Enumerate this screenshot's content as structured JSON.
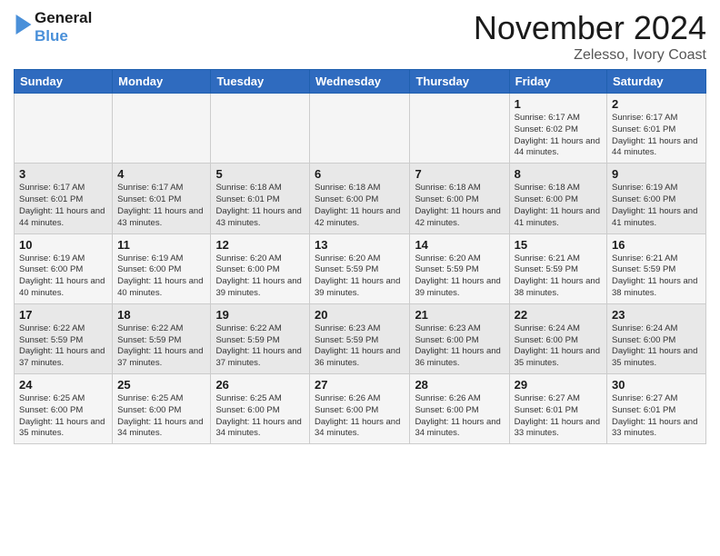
{
  "header": {
    "logo_line1": "General",
    "logo_line2": "Blue",
    "month_title": "November 2024",
    "location": "Zelesso, Ivory Coast"
  },
  "weekdays": [
    "Sunday",
    "Monday",
    "Tuesday",
    "Wednesday",
    "Thursday",
    "Friday",
    "Saturday"
  ],
  "weeks": [
    [
      {
        "day": "",
        "info": ""
      },
      {
        "day": "",
        "info": ""
      },
      {
        "day": "",
        "info": ""
      },
      {
        "day": "",
        "info": ""
      },
      {
        "day": "",
        "info": ""
      },
      {
        "day": "1",
        "info": "Sunrise: 6:17 AM\nSunset: 6:02 PM\nDaylight: 11 hours and 44 minutes."
      },
      {
        "day": "2",
        "info": "Sunrise: 6:17 AM\nSunset: 6:01 PM\nDaylight: 11 hours and 44 minutes."
      }
    ],
    [
      {
        "day": "3",
        "info": "Sunrise: 6:17 AM\nSunset: 6:01 PM\nDaylight: 11 hours and 44 minutes."
      },
      {
        "day": "4",
        "info": "Sunrise: 6:17 AM\nSunset: 6:01 PM\nDaylight: 11 hours and 43 minutes."
      },
      {
        "day": "5",
        "info": "Sunrise: 6:18 AM\nSunset: 6:01 PM\nDaylight: 11 hours and 43 minutes."
      },
      {
        "day": "6",
        "info": "Sunrise: 6:18 AM\nSunset: 6:00 PM\nDaylight: 11 hours and 42 minutes."
      },
      {
        "day": "7",
        "info": "Sunrise: 6:18 AM\nSunset: 6:00 PM\nDaylight: 11 hours and 42 minutes."
      },
      {
        "day": "8",
        "info": "Sunrise: 6:18 AM\nSunset: 6:00 PM\nDaylight: 11 hours and 41 minutes."
      },
      {
        "day": "9",
        "info": "Sunrise: 6:19 AM\nSunset: 6:00 PM\nDaylight: 11 hours and 41 minutes."
      }
    ],
    [
      {
        "day": "10",
        "info": "Sunrise: 6:19 AM\nSunset: 6:00 PM\nDaylight: 11 hours and 40 minutes."
      },
      {
        "day": "11",
        "info": "Sunrise: 6:19 AM\nSunset: 6:00 PM\nDaylight: 11 hours and 40 minutes."
      },
      {
        "day": "12",
        "info": "Sunrise: 6:20 AM\nSunset: 6:00 PM\nDaylight: 11 hours and 39 minutes."
      },
      {
        "day": "13",
        "info": "Sunrise: 6:20 AM\nSunset: 5:59 PM\nDaylight: 11 hours and 39 minutes."
      },
      {
        "day": "14",
        "info": "Sunrise: 6:20 AM\nSunset: 5:59 PM\nDaylight: 11 hours and 39 minutes."
      },
      {
        "day": "15",
        "info": "Sunrise: 6:21 AM\nSunset: 5:59 PM\nDaylight: 11 hours and 38 minutes."
      },
      {
        "day": "16",
        "info": "Sunrise: 6:21 AM\nSunset: 5:59 PM\nDaylight: 11 hours and 38 minutes."
      }
    ],
    [
      {
        "day": "17",
        "info": "Sunrise: 6:22 AM\nSunset: 5:59 PM\nDaylight: 11 hours and 37 minutes."
      },
      {
        "day": "18",
        "info": "Sunrise: 6:22 AM\nSunset: 5:59 PM\nDaylight: 11 hours and 37 minutes."
      },
      {
        "day": "19",
        "info": "Sunrise: 6:22 AM\nSunset: 5:59 PM\nDaylight: 11 hours and 37 minutes."
      },
      {
        "day": "20",
        "info": "Sunrise: 6:23 AM\nSunset: 5:59 PM\nDaylight: 11 hours and 36 minutes."
      },
      {
        "day": "21",
        "info": "Sunrise: 6:23 AM\nSunset: 6:00 PM\nDaylight: 11 hours and 36 minutes."
      },
      {
        "day": "22",
        "info": "Sunrise: 6:24 AM\nSunset: 6:00 PM\nDaylight: 11 hours and 35 minutes."
      },
      {
        "day": "23",
        "info": "Sunrise: 6:24 AM\nSunset: 6:00 PM\nDaylight: 11 hours and 35 minutes."
      }
    ],
    [
      {
        "day": "24",
        "info": "Sunrise: 6:25 AM\nSunset: 6:00 PM\nDaylight: 11 hours and 35 minutes."
      },
      {
        "day": "25",
        "info": "Sunrise: 6:25 AM\nSunset: 6:00 PM\nDaylight: 11 hours and 34 minutes."
      },
      {
        "day": "26",
        "info": "Sunrise: 6:25 AM\nSunset: 6:00 PM\nDaylight: 11 hours and 34 minutes."
      },
      {
        "day": "27",
        "info": "Sunrise: 6:26 AM\nSunset: 6:00 PM\nDaylight: 11 hours and 34 minutes."
      },
      {
        "day": "28",
        "info": "Sunrise: 6:26 AM\nSunset: 6:00 PM\nDaylight: 11 hours and 34 minutes."
      },
      {
        "day": "29",
        "info": "Sunrise: 6:27 AM\nSunset: 6:01 PM\nDaylight: 11 hours and 33 minutes."
      },
      {
        "day": "30",
        "info": "Sunrise: 6:27 AM\nSunset: 6:01 PM\nDaylight: 11 hours and 33 minutes."
      }
    ]
  ]
}
